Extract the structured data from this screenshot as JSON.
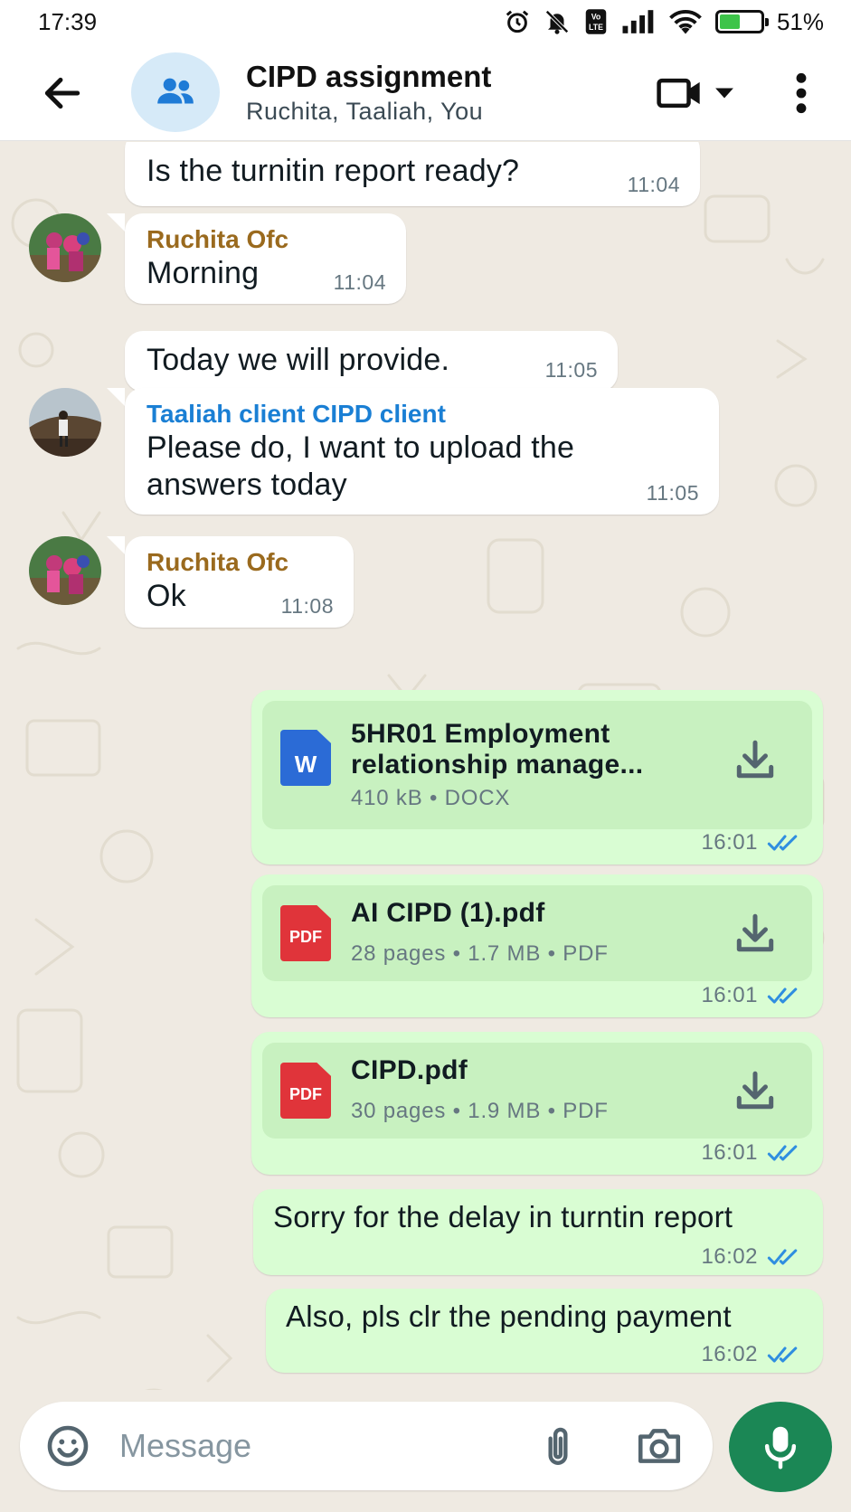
{
  "status_bar": {
    "time": "17:39",
    "battery_percent": "51%",
    "battery_level": 0.51,
    "icons": [
      "alarm-icon",
      "muted-bell-icon",
      "volte-icon",
      "signal-icon",
      "wifi-icon",
      "battery-icon"
    ]
  },
  "header": {
    "title": "CIPD assignment",
    "members": "Ruchita, Taaliah, You",
    "icons": [
      "back-arrow-icon",
      "group-icon",
      "video-call-icon",
      "chevron-down-icon",
      "more-vert-icon"
    ]
  },
  "messages": [
    {
      "direction": "in",
      "text": "Is the turnitin report ready?",
      "time": "11:04"
    },
    {
      "direction": "in",
      "sender": "Ruchita Ofc",
      "text": "Morning",
      "time": "11:04"
    },
    {
      "direction": "in",
      "text": "Today we will provide.",
      "time": "11:05"
    },
    {
      "direction": "in",
      "sender": "Taaliah client CIPD client",
      "text": "Please do, I want to upload the answers today",
      "text_lines": [
        "Please do, I want to upload the",
        "answers today"
      ],
      "time": "11:05"
    },
    {
      "direction": "in",
      "sender": "Ruchita Ofc",
      "text": "Ok",
      "time": "11:08"
    },
    {
      "direction": "out",
      "type": "document",
      "file_type": "DOCX",
      "icon_label": "W",
      "title_lines": [
        "5HR01 Employment",
        "relationship manage..."
      ],
      "meta": "410 kB • DOCX",
      "time": "16:01",
      "status": "read"
    },
    {
      "direction": "out",
      "type": "document",
      "file_type": "PDF",
      "icon_label": "PDF",
      "title_lines": [
        "AI CIPD (1).pdf"
      ],
      "meta": "28 pages  •  1.7 MB • PDF",
      "time": "16:01",
      "status": "read"
    },
    {
      "direction": "out",
      "type": "document",
      "file_type": "PDF",
      "icon_label": "PDF",
      "title_lines": [
        "CIPD.pdf"
      ],
      "meta": "30 pages  •  1.9 MB • PDF",
      "time": "16:01",
      "status": "read"
    },
    {
      "direction": "out",
      "text": "Sorry for the delay in turntin report",
      "time": "16:02",
      "status": "read"
    },
    {
      "direction": "out",
      "text": "Also, pls clr the pending payment",
      "time": "16:02",
      "status": "read"
    }
  ],
  "input": {
    "placeholder": "Message",
    "icons": [
      "emoji-icon",
      "attach-icon",
      "camera-icon",
      "mic-icon"
    ]
  },
  "colors": {
    "sender_ruchita": "#9a6a1e",
    "sender_taaliah": "#1a7fd4",
    "outgoing_bubble": "#d9fdd3",
    "read_ticks": "#2f8ee0",
    "mic_button": "#1b8755",
    "word_icon": "#2b6bd6",
    "pdf_icon": "#e0343a"
  }
}
